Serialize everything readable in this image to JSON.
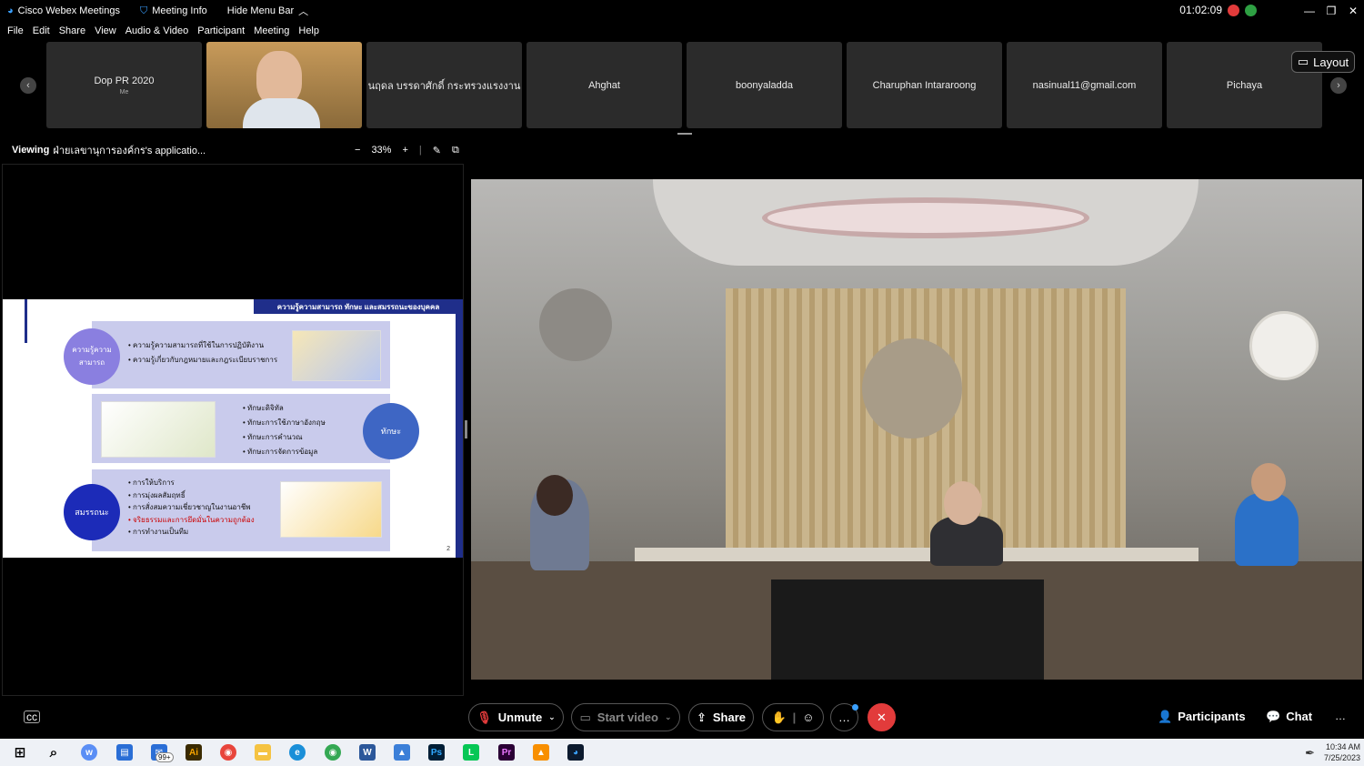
{
  "titlebar": {
    "app_title": "Cisco Webex Meetings",
    "meeting_info": "Meeting Info",
    "hide_menu": "Hide Menu Bar",
    "timer": "01:02:09"
  },
  "menu": [
    "File",
    "Edit",
    "Share",
    "View",
    "Audio & Video",
    "Participant",
    "Meeting",
    "Help"
  ],
  "participants_strip": {
    "tiles": [
      {
        "name": "Dop PR 2020",
        "sub": "Me"
      },
      {
        "name": "",
        "sub": ""
      },
      {
        "name": "นฤดล บรรดาศักดิ์ กระทรวงแรงงาน",
        "sub": ""
      },
      {
        "name": "Ahghat",
        "sub": ""
      },
      {
        "name": "boonyaladda",
        "sub": ""
      },
      {
        "name": "Charuphan Intararoong",
        "sub": ""
      },
      {
        "name": "nasinual11@gmail.com",
        "sub": ""
      },
      {
        "name": "Pichaya",
        "sub": ""
      }
    ],
    "layout_label": "Layout"
  },
  "viewbar": {
    "viewing_prefix": "Viewing",
    "viewing_name": "ฝ่ายเลขานุการองค์กร's applicatio...",
    "zoom": "33%"
  },
  "slide": {
    "header": "ความรู้ความสามารถ ทักษะ และสมรรถนะของบุคคล",
    "circle1": "ความรู้ความสามารถ",
    "circle2": "ทักษะ",
    "circle3": "สมรรถนะ",
    "block1_bullets": [
      "ความรู้ความสามารถที่ใช้ในการปฏิบัติงาน",
      "ความรู้เกี่ยวกับกฎหมายและกฎระเบียบราชการ"
    ],
    "block2_bullets": [
      "ทักษะดิจิทัล",
      "ทักษะการใช้ภาษาอังกฤษ",
      "ทักษะการคำนวณ",
      "ทักษะการจัดการข้อมูล"
    ],
    "block3_bullets": [
      "การให้บริการ",
      "การมุ่งผลสัมฤทธิ์",
      "การสั่งสมความเชี่ยวชาญในงานอาชีพ",
      "จริยธรรมและการยึดมั่นในความถูกต้อง",
      "การทำงานเป็นทีม"
    ],
    "page_number": "2"
  },
  "controls": {
    "unmute": "Unmute",
    "start_video": "Start video",
    "share": "Share",
    "participants": "Participants",
    "chat": "Chat"
  },
  "taskbar": {
    "badge": "99+",
    "time": "10:34 AM",
    "date": "7/25/2023"
  },
  "colors": {
    "end_call": "#e23b3b",
    "slide_navy": "#1f2e8a",
    "slide_block": "#c9cbec"
  }
}
